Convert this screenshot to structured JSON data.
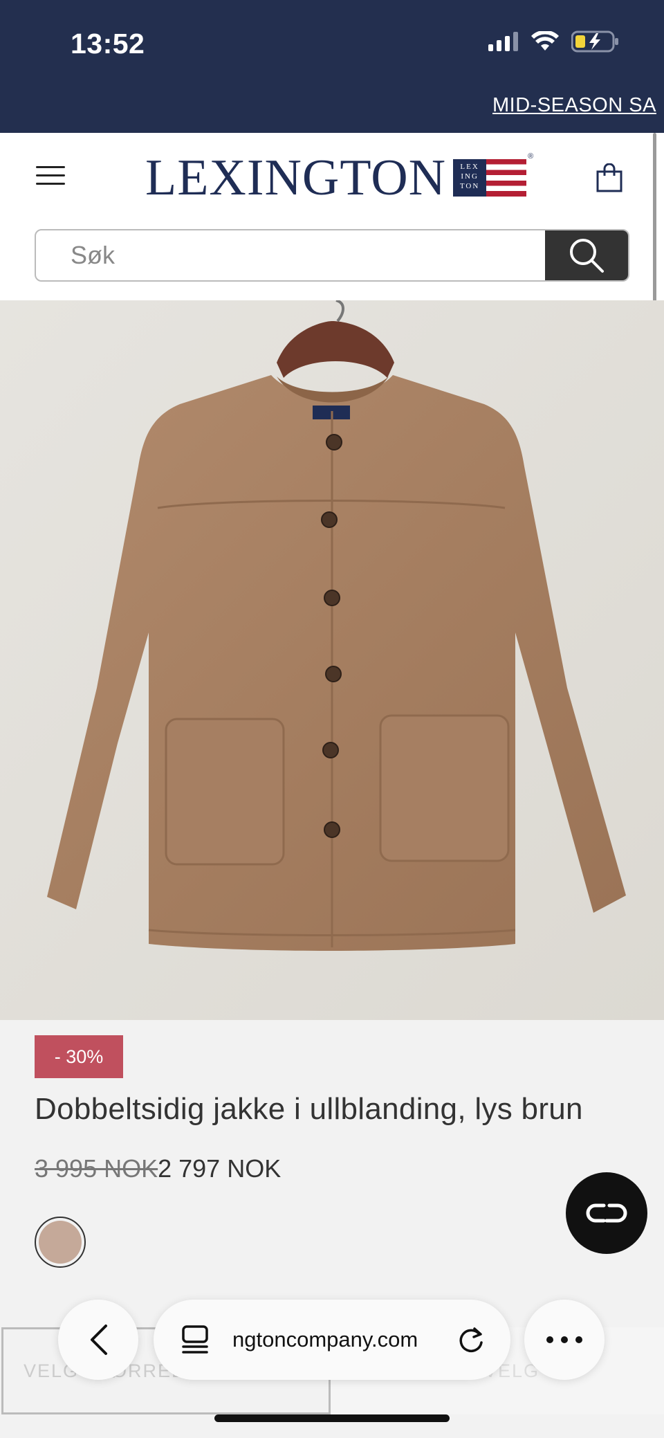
{
  "status": {
    "time": "13:52"
  },
  "promo": {
    "text": "MID-SEASON SA"
  },
  "header": {
    "logo_text": "LEXINGTON",
    "flag_text": "LEX ING TON",
    "registered": "®"
  },
  "search": {
    "placeholder": "Søk"
  },
  "product": {
    "discount_badge": "- 30%",
    "title": "Dobbeltsidig jakke i ullblanding, lys brun",
    "old_price": "3 995 NOK",
    "price": "2 797 NOK",
    "swatch_color": "#c5a999",
    "size_select_label": "VELG STØRRELSE",
    "right_select_label": "VELG"
  },
  "browser": {
    "url": "lexingtoncompany.com",
    "url_visible": "ngtoncompany.com"
  },
  "colors": {
    "navy": "#232f4f",
    "brand_blue": "#1f2d55",
    "brand_red": "#b41f34",
    "discount_red": "#c0505e"
  }
}
